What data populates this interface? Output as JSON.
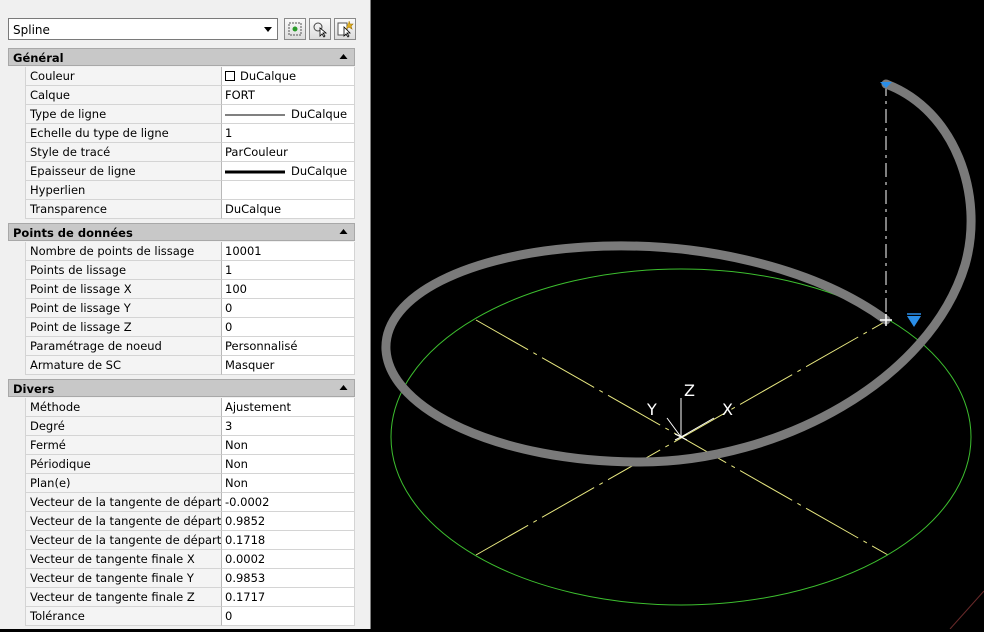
{
  "object_type": "Spline",
  "toolbar": {
    "icons": [
      "quick-select-icon",
      "select-objects-icon",
      "toggle-pickadd-icon"
    ]
  },
  "sections": [
    {
      "title": "Général",
      "rows": [
        {
          "label": "Couleur",
          "value": "DuCalque",
          "swatch": "#ffffff"
        },
        {
          "label": "Calque",
          "value": "FORT"
        },
        {
          "label": "Type de ligne",
          "value": "DuCalque",
          "line": "thin"
        },
        {
          "label": "Echelle du type de ligne",
          "value": "1"
        },
        {
          "label": "Style de tracé",
          "value": "ParCouleur"
        },
        {
          "label": "Epaisseur de ligne",
          "value": "DuCalque",
          "line": "thick"
        },
        {
          "label": "Hyperlien",
          "value": ""
        },
        {
          "label": "Transparence",
          "value": "DuCalque"
        }
      ]
    },
    {
      "title": "Points de données",
      "rows": [
        {
          "label": "Nombre de points de lissage",
          "value": "10001"
        },
        {
          "label": "Points de lissage",
          "value": "1"
        },
        {
          "label": "Point de lissage X",
          "value": "100"
        },
        {
          "label": "Point de lissage Y",
          "value": "0"
        },
        {
          "label": "Point de lissage Z",
          "value": "0"
        },
        {
          "label": "Paramétrage de noeud",
          "value": "Personnalisé"
        },
        {
          "label": "Armature de SC",
          "value": "Masquer"
        }
      ]
    },
    {
      "title": "Divers",
      "rows": [
        {
          "label": "Méthode",
          "value": "Ajustement"
        },
        {
          "label": "Degré",
          "value": "3"
        },
        {
          "label": "Fermé",
          "value": "Non"
        },
        {
          "label": "Périodique",
          "value": "Non"
        },
        {
          "label": "Plan(e)",
          "value": "Non"
        },
        {
          "label": "Vecteur de la tangente de départ X",
          "value": "-0.0002"
        },
        {
          "label": "Vecteur de la tangente de départ Y",
          "value": "0.9852"
        },
        {
          "label": "Vecteur de la tangente de départ Z",
          "value": "0.1718"
        },
        {
          "label": "Vecteur de tangente finale X",
          "value": "0.0002"
        },
        {
          "label": "Vecteur de tangente finale Y",
          "value": "0.9853"
        },
        {
          "label": "Vecteur de tangente finale Z",
          "value": "0.1717"
        },
        {
          "label": "Tolérance",
          "value": "0"
        }
      ]
    }
  ],
  "viewport": {
    "ucs_labels": {
      "x": "X",
      "y": "Y",
      "z": "Z"
    },
    "colors": {
      "background": "#000000",
      "circle": "#3dbf2f",
      "axes": "#e8e880",
      "spline": "#7a7a7a",
      "grip": "#2a8ee8"
    }
  }
}
